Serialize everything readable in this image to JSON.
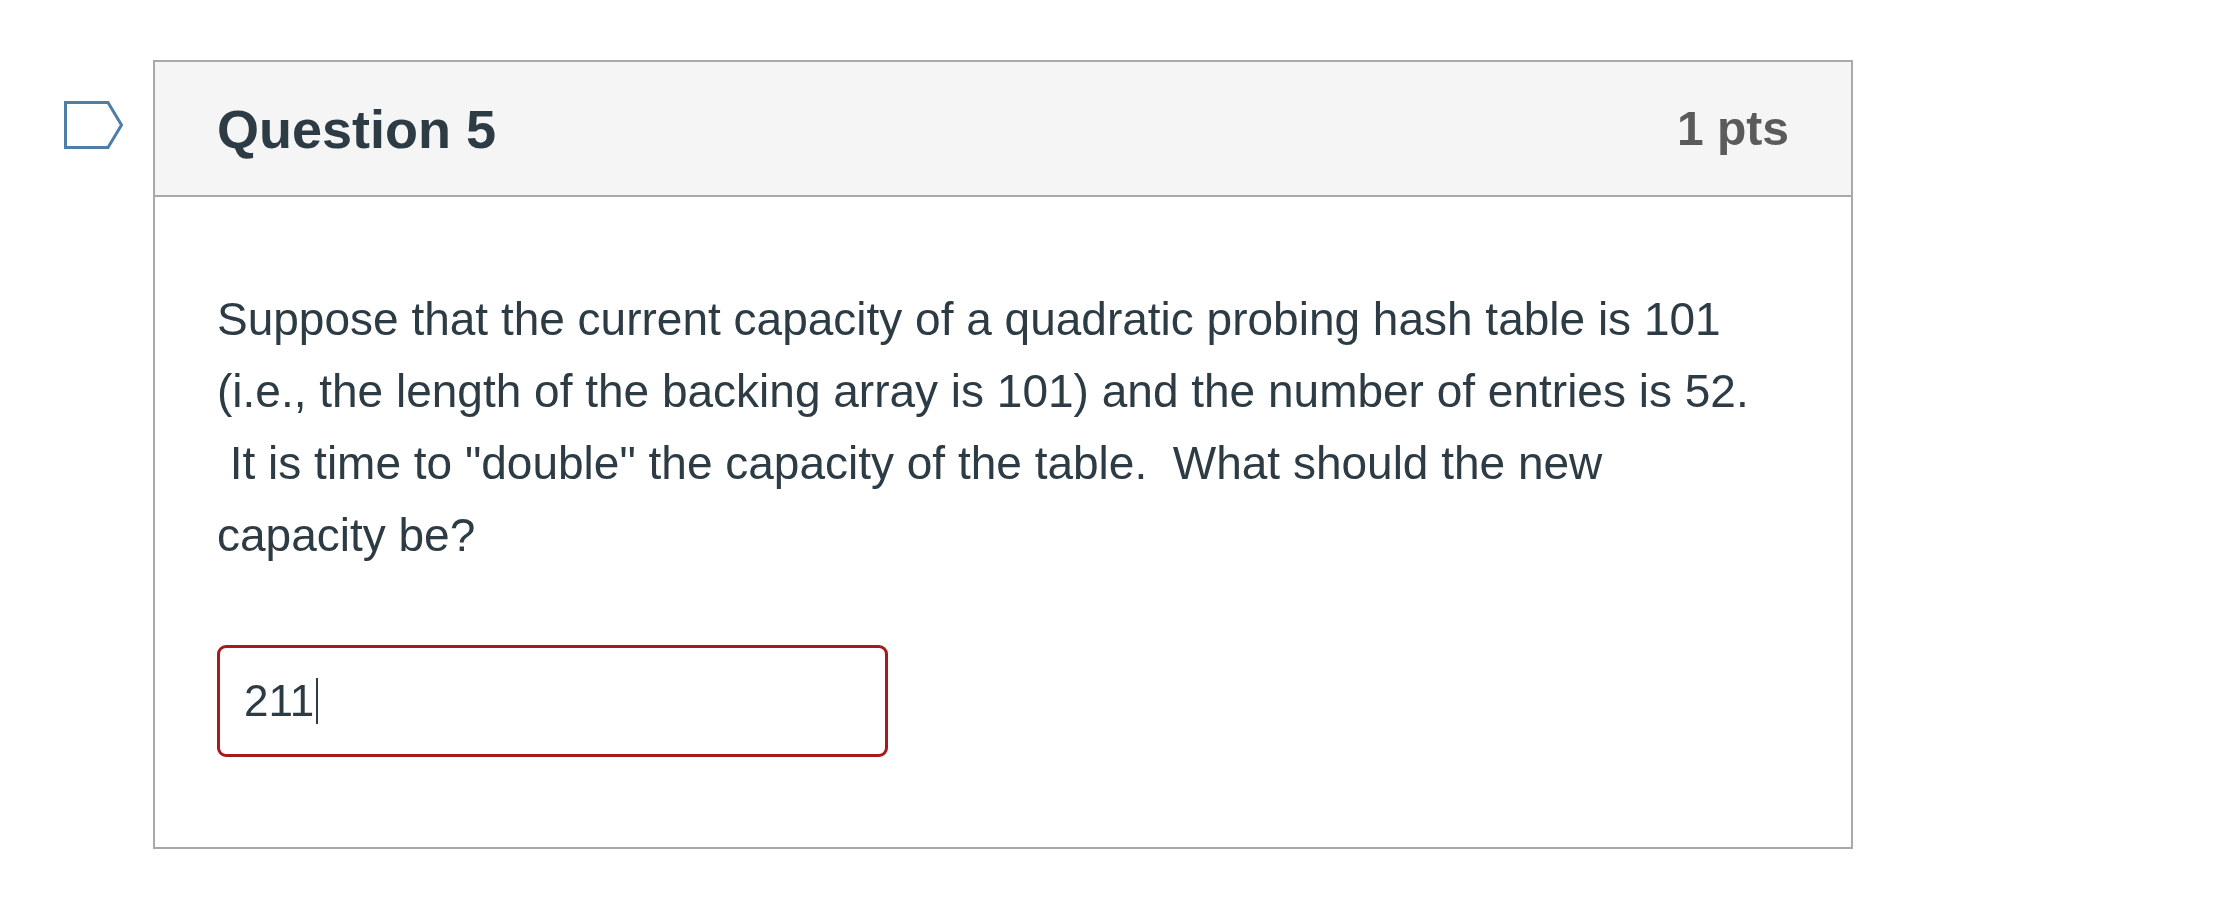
{
  "question": {
    "title": "Question 5",
    "points": "1 pts",
    "text": "Suppose that the current capacity of a quadratic probing hash table is 101 (i.e., the length of the backing array is 101) and the number of entries is 52.  It is time to \"double\" the capacity of the table.  What should the new capacity be?",
    "answer": {
      "value": "211",
      "focused": true
    }
  }
}
